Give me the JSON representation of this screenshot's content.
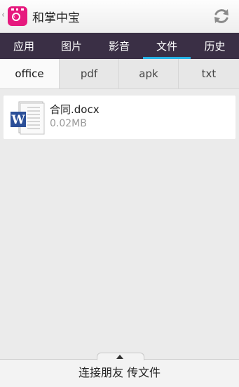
{
  "header": {
    "back_glyph": "‹",
    "title": "和掌中宝"
  },
  "tabs": [
    {
      "label": "应用"
    },
    {
      "label": "图片"
    },
    {
      "label": "影音"
    },
    {
      "label": "文件"
    },
    {
      "label": "历史"
    }
  ],
  "active_tab": "文件",
  "subtabs": [
    {
      "label": "office"
    },
    {
      "label": "pdf"
    },
    {
      "label": "apk"
    },
    {
      "label": "txt"
    }
  ],
  "active_subtab": "office",
  "files": [
    {
      "name": "合同.docx",
      "size": "0.02MB",
      "icon": "word-document-icon"
    }
  ],
  "bottom": {
    "label": "连接朋友  传文件"
  },
  "colors": {
    "tab_bar": "#3a2f45",
    "tab_indicator": "#27b3e6",
    "logo": "#e6197e"
  }
}
